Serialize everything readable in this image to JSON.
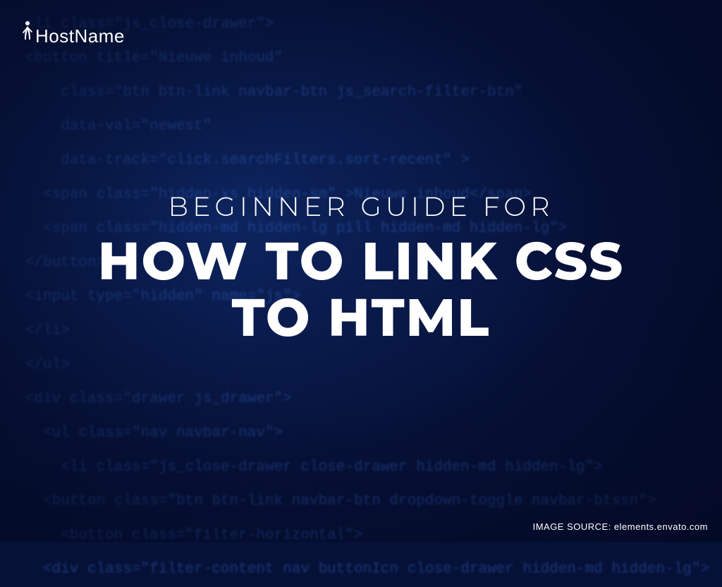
{
  "logo": {
    "text": "HostName"
  },
  "hero": {
    "subtitle": "BEGINNER GUIDE FOR",
    "title_line1": "HOW TO LINK CSS",
    "title_line2": "TO HTML"
  },
  "credit": {
    "label": "IMAGE SOURCE: elements.envato.com"
  },
  "bg_code": {
    "l1": "<li class=\"js_close-drawer\">",
    "l2": "<button title=\"Nieuwe inhoud\"",
    "l3": "class=\"btn btn-link navbar-btn js_search-filter-btn\"",
    "l4": "data-val=\"newest\"",
    "l5": "data-track=\"click.searchFilters.sort-recent\" >",
    "l6": "<span class=\"hidden-xs hidden-sm\" >Nieuwe inhoud</span>",
    "l7": "<span class=\"hidden-md hidden-lg pill hidden-md hidden-lg\">",
    "l8": "</button>",
    "l9": "<input type=\"hidden\" name=\"js\">",
    "l10": "</li>",
    "l11": "</ul>",
    "l12": "<div class=\"drawer js_drawer\">",
    "l13": "<ul class=\"nav navbar-nav\">",
    "l14": "<li class=\"js_close-drawer close-drawer hidden-md hidden-lg\">",
    "l15": "<button class=\"btn btn-link navbar-btn dropdown-toggle navbar-btssn\">",
    "l16": "<button class=\"filter-horizontal\">",
    "l17": "<div class=\"filter-content nav buttonIcn close-drawer hidden-md hidden-lg\">"
  }
}
